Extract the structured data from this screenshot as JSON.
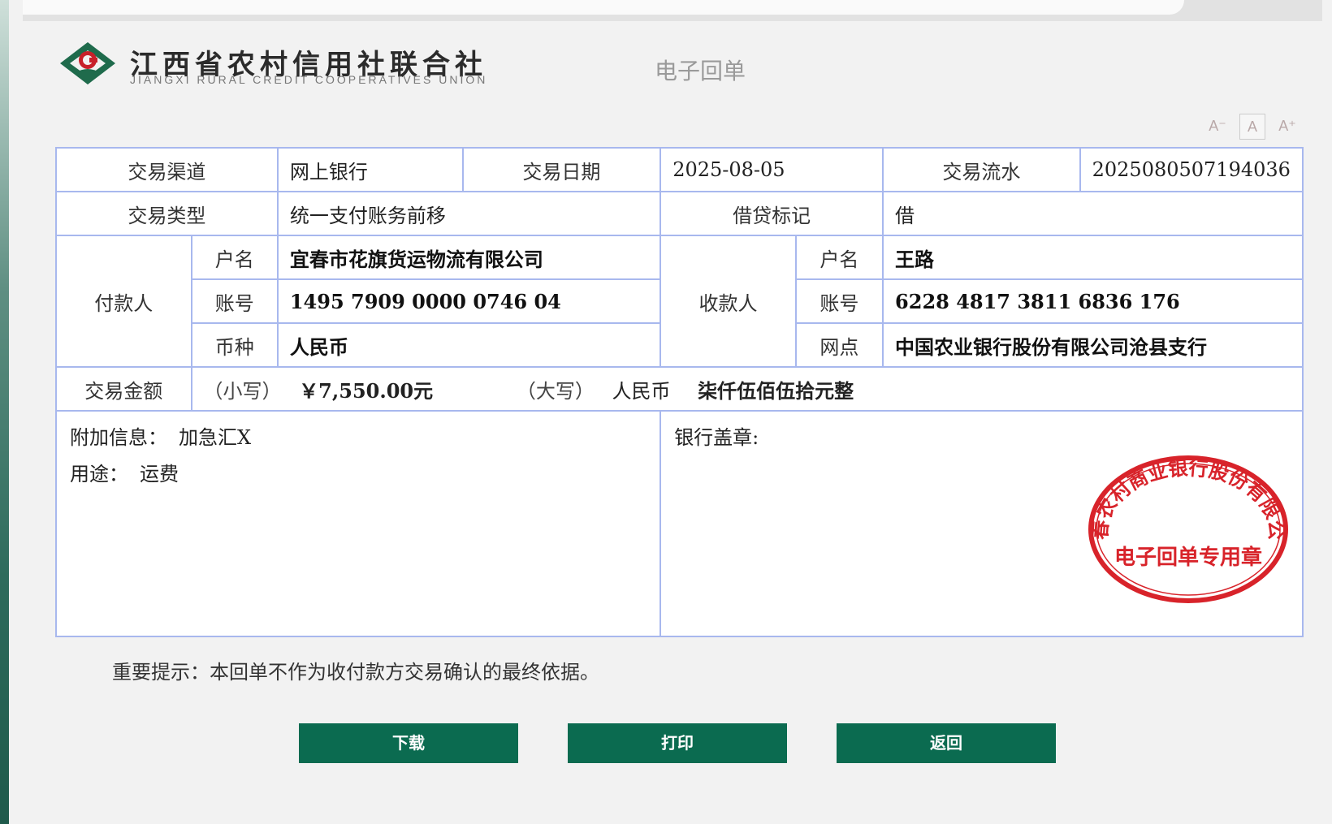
{
  "header": {
    "org_name_cn": "江西省农村信用社联合社",
    "org_name_en": "JIANGXI  RURAL  CREDIT  COOPERATIVES  UNION",
    "doc_title": "电子回单"
  },
  "font_controls": {
    "decrease": "A⁻",
    "reset": "A",
    "increase": "A⁺"
  },
  "receipt": {
    "channel_label": "交易渠道",
    "channel": "网上银行",
    "date_label": "交易日期",
    "date": "2025-08-05",
    "serial_label": "交易流水",
    "serial": "2025080507194036",
    "type_label": "交易类型",
    "type": "统一支付账务前移",
    "dc_label": "借贷标记",
    "dc": "借",
    "payer": {
      "label": "付款人",
      "name_label": "户名",
      "name": "宜春市花旗货运物流有限公司",
      "account_label": "账号",
      "account": "1495 7909 0000 0746 04",
      "currency_label": "币种",
      "currency": "人民币"
    },
    "payee": {
      "label": "收款人",
      "name_label": "户名",
      "name": "王路",
      "account_label": "账号",
      "account": "6228 4817 3811 6836 176",
      "branch_label": "网点",
      "branch": "中国农业银行股份有限公司沧县支行"
    },
    "amount_label": "交易金额",
    "amount_small_label": "（小写）",
    "amount_small": "￥7,550.00元",
    "amount_big_label": "（大写）",
    "amount_big_prefix": "人民币",
    "amount_big": "柒仟伍佰伍拾元整",
    "extra_label": "附加信息：",
    "extra": "加急汇X",
    "purpose_label": "用途：",
    "purpose": "运费",
    "seal_label": "银行盖章:",
    "stamp_text_outer": "宜春农村商业银行股份有限公司",
    "stamp_text_inner": "电子回单专用章"
  },
  "notice": "重要提示：本回单不作为收付款方交易确认的最终依据。",
  "buttons": {
    "download": "下载",
    "print": "打印",
    "back": "返回"
  },
  "colors": {
    "button": "#0b6b50",
    "border": "#a8b8ee",
    "stamp": "#d8232a",
    "logo": "#1f6b4c"
  }
}
